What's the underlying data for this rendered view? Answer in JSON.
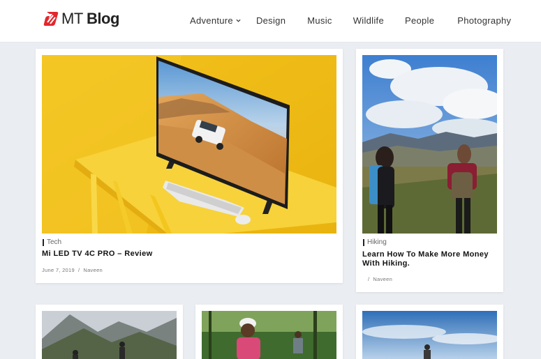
{
  "header": {
    "logo_mt": "MT",
    "logo_blog": "Blog",
    "nav": [
      {
        "label": "Adventure",
        "has_dropdown": true
      },
      {
        "label": "Design"
      },
      {
        "label": "Music"
      },
      {
        "label": "Wildlife"
      },
      {
        "label": "People"
      },
      {
        "label": "Photography"
      }
    ]
  },
  "posts": [
    {
      "category": "Tech",
      "title": "Mi LED TV 4C PRO – Review",
      "date": "June 7, 2019",
      "separator": "/",
      "author": "Naveen"
    },
    {
      "category": "Hiking",
      "title": "Learn How To Make More Money With Hiking.",
      "date": "",
      "separator": "/",
      "author": "Naveen"
    }
  ],
  "colors": {
    "accent": "#e3262d",
    "background": "#eaedf1"
  }
}
